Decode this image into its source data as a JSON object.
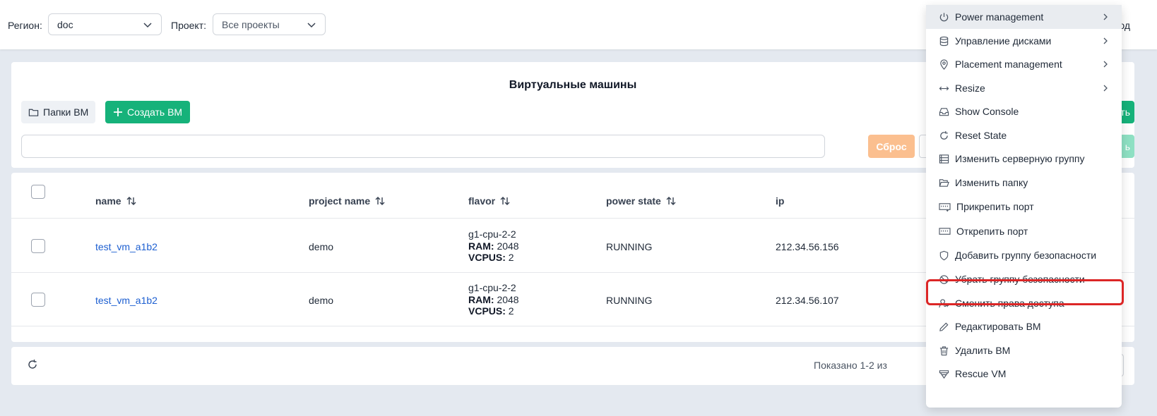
{
  "topbar": {
    "region_label": "Регион:",
    "region_value": "doc",
    "project_label": "Проект:",
    "project_value": "Все проекты",
    "right_text": "од"
  },
  "header": {
    "title": "Виртуальные машины",
    "folders_button": "Папки ВМ",
    "create_button": "Создать ВМ",
    "right_button_fragment": "ть",
    "reset_button": "Сброс",
    "right_button2_fragment": "ь"
  },
  "table": {
    "columns": [
      "name",
      "project name",
      "flavor",
      "power state",
      "ip"
    ],
    "rows": [
      {
        "name": "test_vm_a1b2",
        "project": "demo",
        "flavor": "g1-cpu-2-2",
        "ram_label": "RAM:",
        "ram": "2048",
        "vcpus_label": "VCPUS:",
        "vcpus": "2",
        "state": "RUNNING",
        "ip": "212.34.56.156"
      },
      {
        "name": "test_vm_a1b2",
        "project": "demo",
        "flavor": "g1-cpu-2-2",
        "ram_label": "RAM:",
        "ram": "2048",
        "vcpus_label": "VCPUS:",
        "vcpus": "2",
        "state": "RUNNING",
        "ip": "212.34.56.107"
      }
    ]
  },
  "footer": {
    "pager_text": "Показано 1-2 из"
  },
  "menu": {
    "items": [
      {
        "label": "Power management",
        "icon": "power-icon",
        "submenu": true,
        "active": true
      },
      {
        "label": "Управление дисками",
        "icon": "database-icon",
        "submenu": true
      },
      {
        "label": "Placement management",
        "icon": "map-pin-icon",
        "submenu": true
      },
      {
        "label": "Resize",
        "icon": "resize-arrows-icon",
        "submenu": true
      },
      {
        "label": "Show Console",
        "icon": "inbox-icon"
      },
      {
        "label": "Reset State",
        "icon": "rotate-icon"
      },
      {
        "label": "Изменить серверную группу",
        "icon": "server-group-icon"
      },
      {
        "label": "Изменить папку",
        "icon": "folder-open-icon"
      },
      {
        "label": "Прикрепить порт",
        "icon": "port-attach-icon"
      },
      {
        "label": "Открепить порт",
        "icon": "port-detach-icon"
      },
      {
        "label": "Добавить группу безопасности",
        "icon": "shield-icon"
      },
      {
        "label": "Убрать группу безопасности",
        "icon": "ban-icon",
        "highlighted": true
      },
      {
        "label": "Сменить права доступа",
        "icon": "user-key-icon"
      },
      {
        "label": "Редактировать ВМ",
        "icon": "pencil-icon"
      },
      {
        "label": "Удалить ВМ",
        "icon": "trash-icon"
      },
      {
        "label": "Rescue VM",
        "icon": "rescue-icon"
      }
    ]
  },
  "colors": {
    "accent_green": "#16b27a",
    "link_blue": "#1d5fd1",
    "highlight_red": "#dc2626",
    "reset_orange": "#fbbf8f"
  }
}
